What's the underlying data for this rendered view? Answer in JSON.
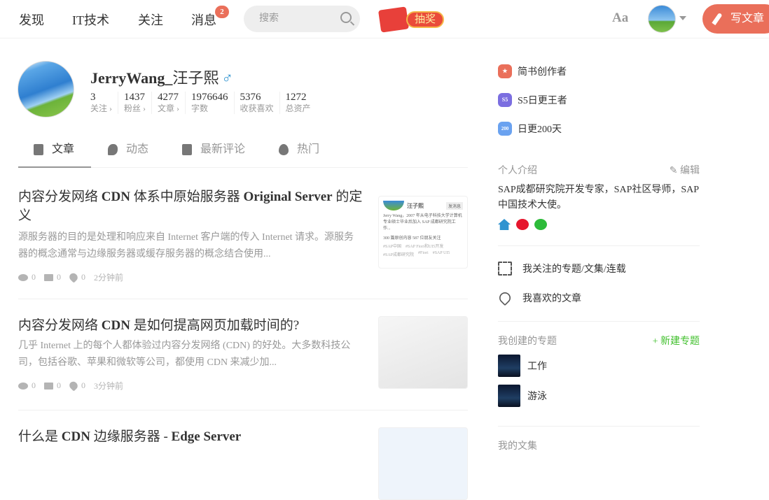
{
  "nav": {
    "items": [
      "发现",
      "IT技术",
      "关注",
      "消息"
    ],
    "message_badge": "2",
    "search_placeholder": "搜索",
    "lottery": "抽奖",
    "font_toggle": "Aa",
    "write": "写文章"
  },
  "profile": {
    "name_latin": "JerryWang_",
    "name_cn": "汪子熙",
    "gender": "♂",
    "stats": [
      {
        "n": "3",
        "l": "关注 ›"
      },
      {
        "n": "1437",
        "l": "粉丝 ›"
      },
      {
        "n": "4277",
        "l": "文章 ›"
      },
      {
        "n": "1976646",
        "l": "字数"
      },
      {
        "n": "5376",
        "l": "收获喜欢"
      },
      {
        "n": "1272",
        "l": "总资产"
      }
    ]
  },
  "tabs": [
    "文章",
    "动态",
    "最新评论",
    "热门"
  ],
  "articles": [
    {
      "title_a": "内容分发网络 ",
      "title_b": "CDN",
      "title_c": " 体系中原始服务器 ",
      "title_d": "Original Server",
      "title_e": " 的定义",
      "abstract": "源服务器的目的是处理和响应来自 Internet 客户端的传入 Internet 请求。源服务器的概念通常与边缘服务器或缓存服务器的概念结合使用...",
      "views": "0",
      "comments": "0",
      "likes": "0",
      "time": "2分钟前",
      "thumb": {
        "name": "汪子熙",
        "btn": "发消息",
        "bio": "Jerry Wang，2007 年从电子科技大学计算机专业硕士毕业后加入 SAP 成都研究院工作...",
        "counts": "300 篇原创内容  587 位朋友关注",
        "tags": [
          "#SAP中国",
          "#SAP Fiori和UI5开发",
          "#SAP成都研究院",
          "#Fiori",
          "#SAP UI5"
        ]
      }
    },
    {
      "title_a": "内容分发网络 ",
      "title_b": "CDN",
      "title_c": " 是如何提高网页加载时间的?",
      "title_d": "",
      "title_e": "",
      "abstract": "几乎 Internet 上的每个人都体验过内容分发网络 (CDN) 的好处。大多数科技公司，包括谷歌、苹果和微软等公司，都使用 CDN 来减少加...",
      "views": "0",
      "comments": "0",
      "likes": "0",
      "time": "3分钟前"
    },
    {
      "title_a": "什么是 ",
      "title_b": "CDN",
      "title_c": " 边缘服务器 - ",
      "title_d": "Edge Server",
      "title_e": ""
    }
  ],
  "sidebar": {
    "honors": [
      {
        "label": "简书创作者",
        "color": "#ea6f5a",
        "mark": "★"
      },
      {
        "label": "S5日更王者",
        "color": "#7b6ee0",
        "mark": "S5"
      },
      {
        "label": "日更200天",
        "color": "#6aa2f0",
        "mark": "200"
      }
    ],
    "intro_title": "个人介绍",
    "edit": "编辑",
    "intro": "SAP成都研究院开发专家，SAP社区导师，SAP中国技术大使。",
    "links": [
      "我关注的专题/文集/连载",
      "我喜欢的文章"
    ],
    "collections_title": "我创建的专题",
    "new_collection": "+ 新建专题",
    "collections": [
      "工作",
      "游泳"
    ],
    "notebooks_title": "我的文集"
  }
}
